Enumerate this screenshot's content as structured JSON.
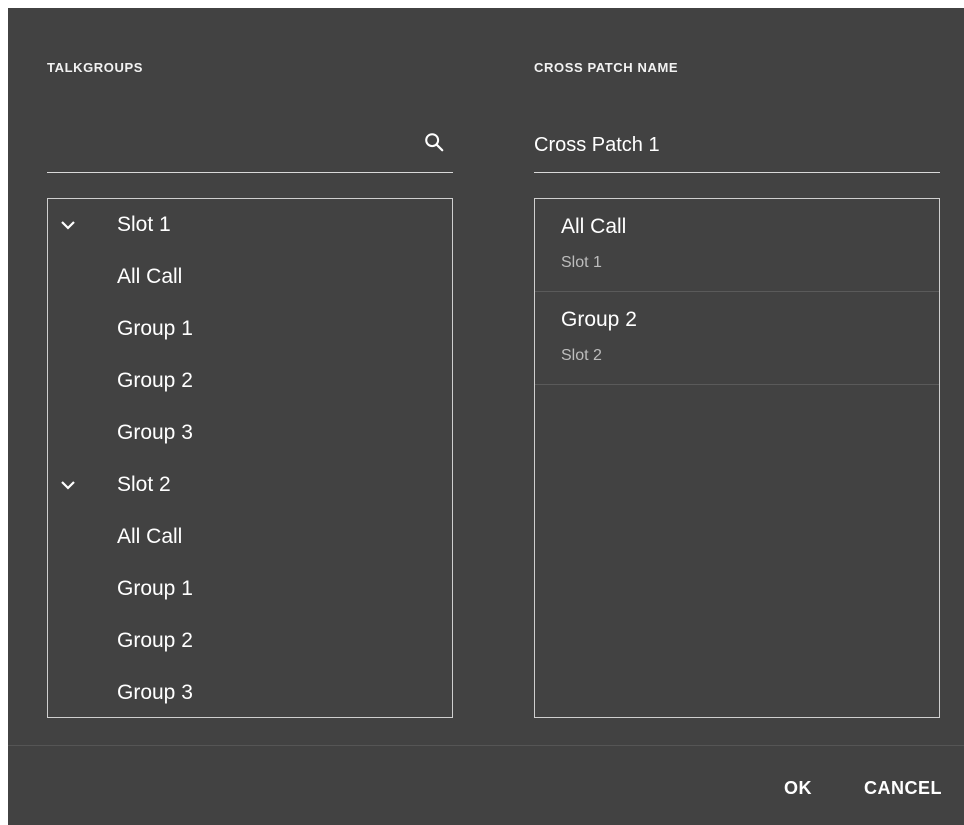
{
  "talkgroups": {
    "label": "TALKGROUPS",
    "search_value": "",
    "search_icon": "search-icon",
    "tree": [
      {
        "type": "header",
        "label": "Slot 1",
        "expanded": true
      },
      {
        "type": "item",
        "label": "All Call"
      },
      {
        "type": "item",
        "label": "Group 1"
      },
      {
        "type": "item",
        "label": "Group 2"
      },
      {
        "type": "item",
        "label": "Group 3"
      },
      {
        "type": "header",
        "label": "Slot 2",
        "expanded": true
      },
      {
        "type": "item",
        "label": "All Call"
      },
      {
        "type": "item",
        "label": "Group 1"
      },
      {
        "type": "item",
        "label": "Group 2"
      },
      {
        "type": "item",
        "label": "Group 3"
      }
    ]
  },
  "cross_patch": {
    "label": "CROSS PATCH NAME",
    "name_value": "Cross Patch 1",
    "selected": [
      {
        "title": "All Call",
        "slot": "Slot 1"
      },
      {
        "title": "Group 2",
        "slot": "Slot 2"
      }
    ]
  },
  "footer": {
    "ok_label": "OK",
    "cancel_label": "CANCEL"
  },
  "colors": {
    "dialog_bg": "#424242",
    "text": "#ffffff",
    "muted_text": "#bdbdbd",
    "border": "#cfcfcf"
  }
}
